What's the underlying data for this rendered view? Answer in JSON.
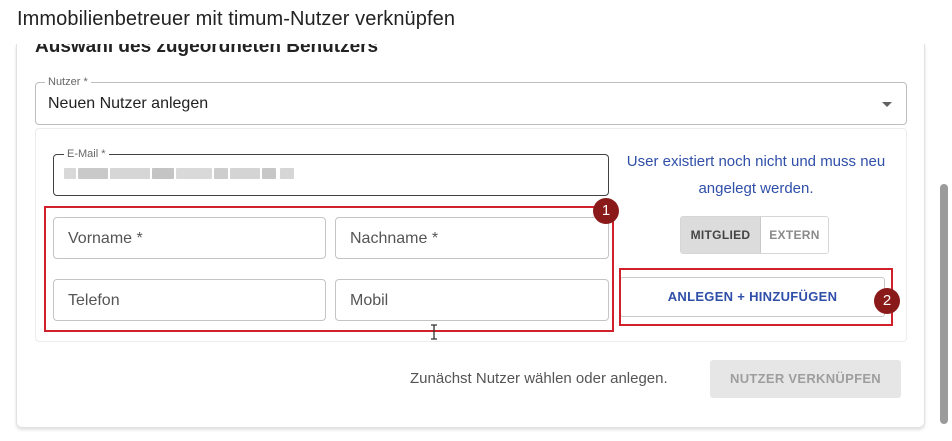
{
  "dialog": {
    "title": "Immobilienbetreuer mit timum-Nutzer verknüpfen"
  },
  "section": {
    "heading": "Auswahl des zugeordneten Benutzers"
  },
  "user_select": {
    "label": "Nutzer *",
    "value": "Neuen Nutzer anlegen"
  },
  "email": {
    "label": "E-Mail *",
    "value_redacted": true
  },
  "info": {
    "text": "User existiert noch nicht und muss neu angelegt werden."
  },
  "fields": {
    "vorname": "Vorname *",
    "nachname": "Nachname *",
    "telefon": "Telefon",
    "mobil": "Mobil"
  },
  "toggle": {
    "options": [
      "MITGLIED",
      "EXTERN"
    ],
    "selected": "MITGLIED"
  },
  "create_button": {
    "label": "ANLEGEN + HINZUFÜGEN"
  },
  "annotations": {
    "badge_1": "1",
    "badge_2": "2"
  },
  "footer": {
    "hint": "Zunächst Nutzer wählen oder anlegen.",
    "link_button": "NUTZER VERKNÜPFEN"
  },
  "colors": {
    "accent": "#2f4fa8",
    "highlight": "#d0212b",
    "badge": "#8a1a1a"
  }
}
